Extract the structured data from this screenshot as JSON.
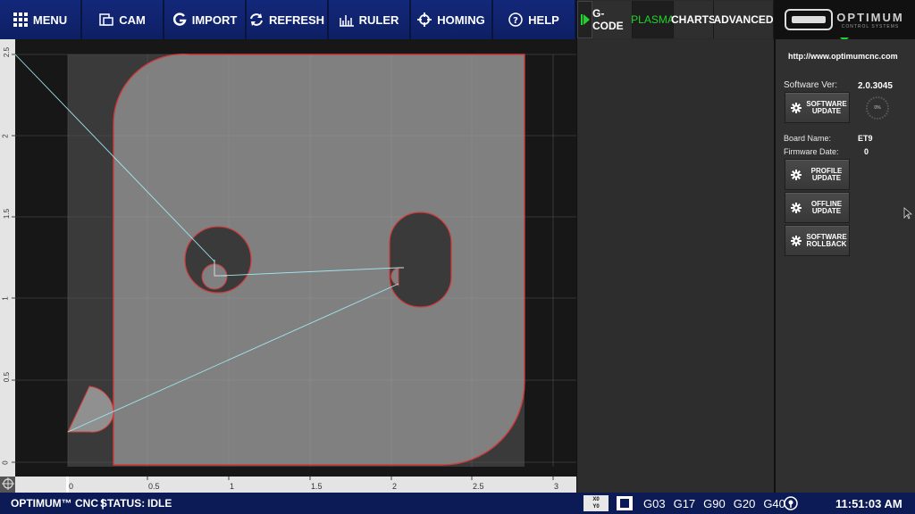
{
  "toolbar": {
    "buttons": [
      {
        "label": "MENU",
        "icon": "grid-icon"
      },
      {
        "label": "CAM",
        "icon": "cam-icon"
      },
      {
        "label": "IMPORT",
        "icon": "import-icon"
      },
      {
        "label": "REFRESH",
        "icon": "refresh-icon"
      },
      {
        "label": "RULER",
        "icon": "ruler-icon"
      },
      {
        "label": "HOMING",
        "icon": "crosshair-icon"
      },
      {
        "label": "HELP",
        "icon": "help-icon"
      }
    ]
  },
  "tabs": {
    "items": [
      "G-CODE",
      "PLASMA",
      "CHARTS",
      "ADVANCED"
    ],
    "active": "PLASMA"
  },
  "logo": {
    "text": "OPTIMUM",
    "subtext": "CONTROL SYSTEMS"
  },
  "canvas": {
    "x_ticks": [
      "0",
      "0.5",
      "1",
      "1.5",
      "2",
      "2.5",
      "3"
    ],
    "y_ticks": [
      "2.5",
      "2",
      "1.5",
      "1",
      "0.5",
      "0"
    ]
  },
  "panel": {
    "url": "http://www.optimumcnc.com",
    "software_ver_label": "Software Ver:",
    "software_ver_value": "2.0.3045",
    "progress_text": "0%",
    "board_name_label": "Board Name:",
    "board_name_value": "ET9",
    "firmware_date_label": "Firmware Date:",
    "firmware_date_value": "0",
    "buttons": {
      "software_update": "SOFTWARE\nUPDATE",
      "profile_update": "PROFILE\nUPDATE",
      "offline_update": "OFFLINE\nUPDATE",
      "software_rollback": "SOFTWARE\nROLLBACK"
    }
  },
  "status": {
    "brand": "OPTIMUM™ CNC  |",
    "status_label": "STATUS:",
    "status_value": "IDLE",
    "xy_top": "X0",
    "xy_bottom": "Y0",
    "codes": [
      "G03",
      "G17",
      "G90",
      "G20",
      "G40"
    ],
    "time": "11:51:03 AM"
  },
  "colors": {
    "toolbar_bg": "#0e1f63",
    "status_bg": "#0c1a55",
    "active_tab": "#23d12c",
    "part_fill": "#808080",
    "path_red": "#d23a3a",
    "travel_line": "#9fe6ef"
  }
}
